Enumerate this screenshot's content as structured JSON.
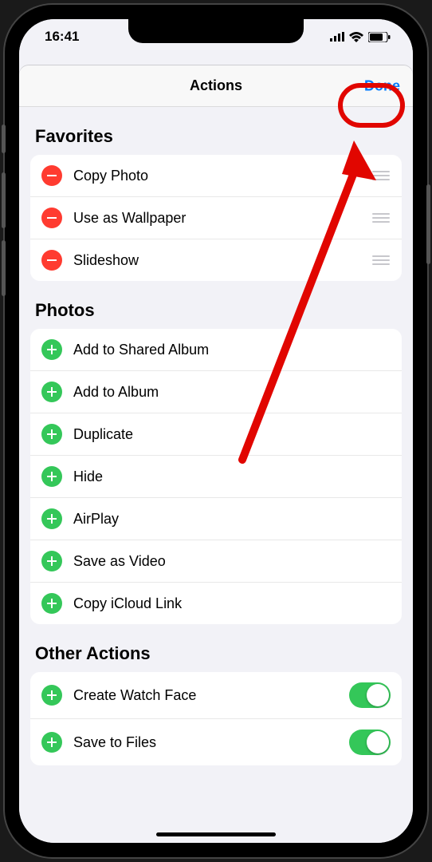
{
  "status": {
    "time": "16:41"
  },
  "nav": {
    "title": "Actions",
    "done": "Done"
  },
  "favorites": {
    "header": "Favorites",
    "items": [
      {
        "label": "Copy Photo"
      },
      {
        "label": "Use as Wallpaper"
      },
      {
        "label": "Slideshow"
      }
    ]
  },
  "photos": {
    "header": "Photos",
    "items": [
      {
        "label": "Add to Shared Album"
      },
      {
        "label": "Add to Album"
      },
      {
        "label": "Duplicate"
      },
      {
        "label": "Hide"
      },
      {
        "label": "AirPlay"
      },
      {
        "label": "Save as Video"
      },
      {
        "label": "Copy iCloud Link"
      }
    ]
  },
  "other": {
    "header": "Other Actions",
    "items": [
      {
        "label": "Create Watch Face",
        "toggle": true
      },
      {
        "label": "Save to Files",
        "toggle": true
      }
    ]
  }
}
